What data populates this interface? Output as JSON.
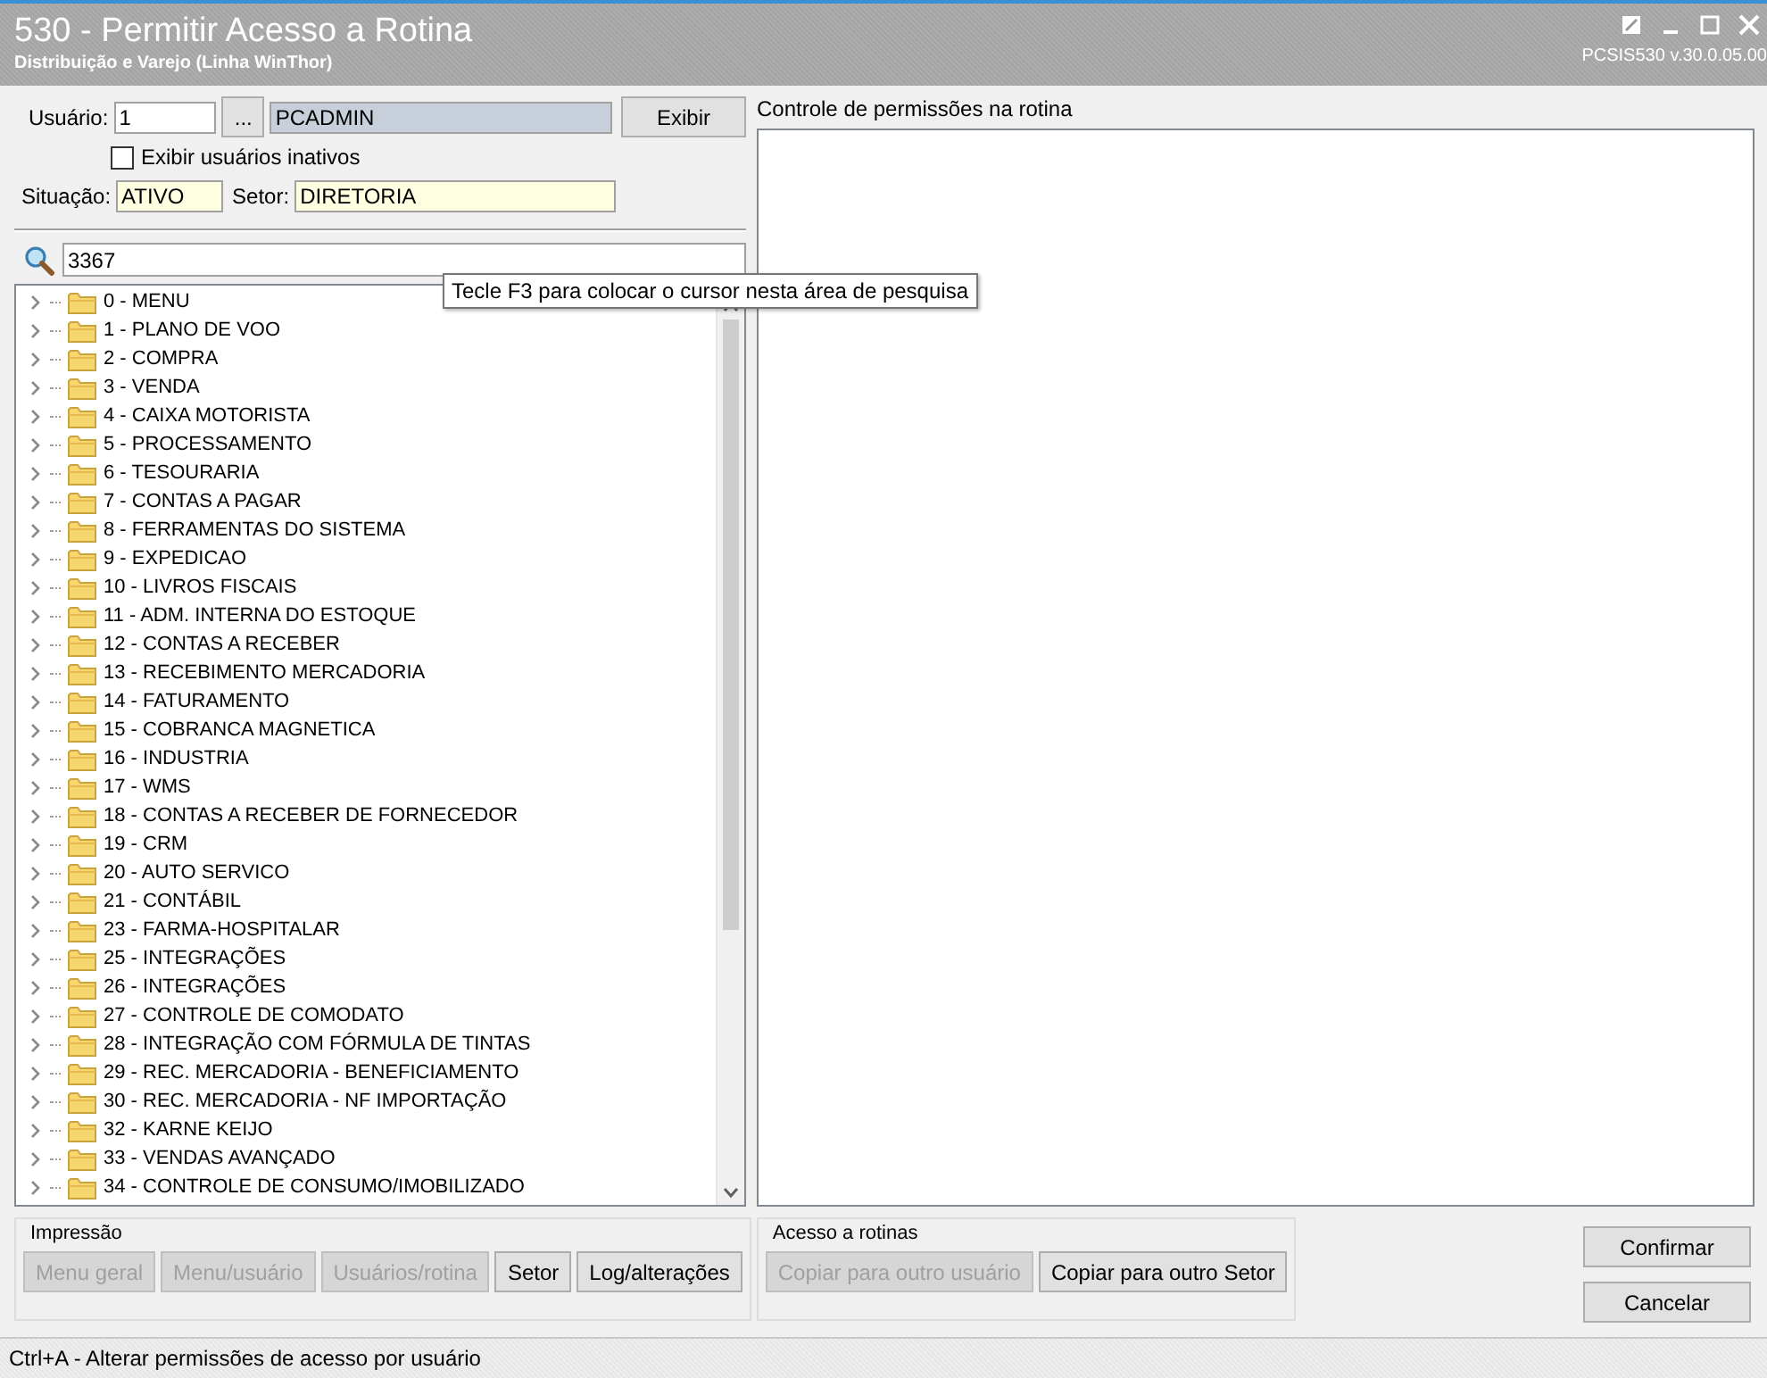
{
  "window": {
    "title": "530 - Permitir Acesso a Rotina",
    "subtitle": "Distribuição e Varejo (Linha WinThor)",
    "version": "PCSIS530  v.30.0.05.00"
  },
  "user_form": {
    "user_label": "Usuário:",
    "user_code": "1",
    "lookup_button": "...",
    "user_name": "PCADMIN",
    "show_button": "Exibir",
    "inactive_checkbox": {
      "label": "Exibir usuários inativos",
      "checked": false
    },
    "status_label": "Situação:",
    "status_value": "ATIVO",
    "sector_label": "Setor:",
    "sector_value": "DIRETORIA"
  },
  "search": {
    "value": "3367",
    "tooltip": "Tecle F3 para colocar o cursor nesta área de pesquisa"
  },
  "tree": {
    "items": [
      {
        "label": "0 - MENU",
        "expanded": false
      },
      {
        "label": "1 - PLANO DE VOO",
        "expanded": false
      },
      {
        "label": "2 - COMPRA",
        "expanded": false
      },
      {
        "label": "3 - VENDA",
        "expanded": false
      },
      {
        "label": "4 - CAIXA MOTORISTA",
        "expanded": false
      },
      {
        "label": "5 - PROCESSAMENTO",
        "expanded": false
      },
      {
        "label": "6 - TESOURARIA",
        "expanded": false
      },
      {
        "label": "7 - CONTAS A PAGAR",
        "expanded": false
      },
      {
        "label": "8 - FERRAMENTAS DO SISTEMA",
        "expanded": false
      },
      {
        "label": "9 - EXPEDICAO",
        "expanded": false
      },
      {
        "label": "10 - LIVROS FISCAIS",
        "expanded": false
      },
      {
        "label": "11 - ADM. INTERNA DO ESTOQUE",
        "expanded": false
      },
      {
        "label": "12 - CONTAS A RECEBER",
        "expanded": false
      },
      {
        "label": "13 - RECEBIMENTO MERCADORIA",
        "expanded": false
      },
      {
        "label": "14 - FATURAMENTO",
        "expanded": false
      },
      {
        "label": "15 - COBRANCA MAGNETICA",
        "expanded": false
      },
      {
        "label": "16 - INDUSTRIA",
        "expanded": false
      },
      {
        "label": "17 - WMS",
        "expanded": false
      },
      {
        "label": "18 - CONTAS A RECEBER DE FORNECEDOR",
        "expanded": false
      },
      {
        "label": "19 - CRM",
        "expanded": false
      },
      {
        "label": "20 - AUTO SERVICO",
        "expanded": false
      },
      {
        "label": "21 - CONTÁBIL",
        "expanded": false
      },
      {
        "label": "23 - FARMA-HOSPITALAR",
        "expanded": false
      },
      {
        "label": "25 - INTEGRAÇÕES",
        "expanded": false
      },
      {
        "label": "26 - INTEGRAÇÕES",
        "expanded": false
      },
      {
        "label": "27 - CONTROLE DE COMODATO",
        "expanded": false
      },
      {
        "label": "28 - INTEGRAÇÃO COM FÓRMULA DE TINTAS",
        "expanded": false
      },
      {
        "label": "29 - REC. MERCADORIA - BENEFICIAMENTO",
        "expanded": false
      },
      {
        "label": "30 - REC. MERCADORIA - NF IMPORTAÇÃO",
        "expanded": false
      },
      {
        "label": "32 - KARNE KEIJO",
        "expanded": false
      },
      {
        "label": "33 - VENDAS AVANÇADO",
        "expanded": false
      },
      {
        "label": "34 - CONTROLE DE CONSUMO/IMOBILIZADO",
        "expanded": false
      }
    ]
  },
  "permissions_panel": {
    "title": "Controle de permissões na rotina"
  },
  "print_group": {
    "title": "Impressão",
    "buttons": [
      {
        "label": "Menu geral",
        "disabled": true
      },
      {
        "label": "Menu/usuário",
        "disabled": true
      },
      {
        "label": "Usuários/rotina",
        "disabled": true
      },
      {
        "label": "Setor",
        "disabled": false
      },
      {
        "label": "Log/alterações",
        "disabled": false
      }
    ]
  },
  "access_group": {
    "title": "Acesso a rotinas",
    "buttons": [
      {
        "label": "Copiar para outro usuário",
        "disabled": true
      },
      {
        "label": "Copiar para outro Setor",
        "disabled": false
      }
    ]
  },
  "actions": [
    {
      "label": "Confirmar"
    },
    {
      "label": "Cancelar"
    }
  ],
  "status_bar": "Ctrl+A - Alterar permissões de acesso por usuário"
}
